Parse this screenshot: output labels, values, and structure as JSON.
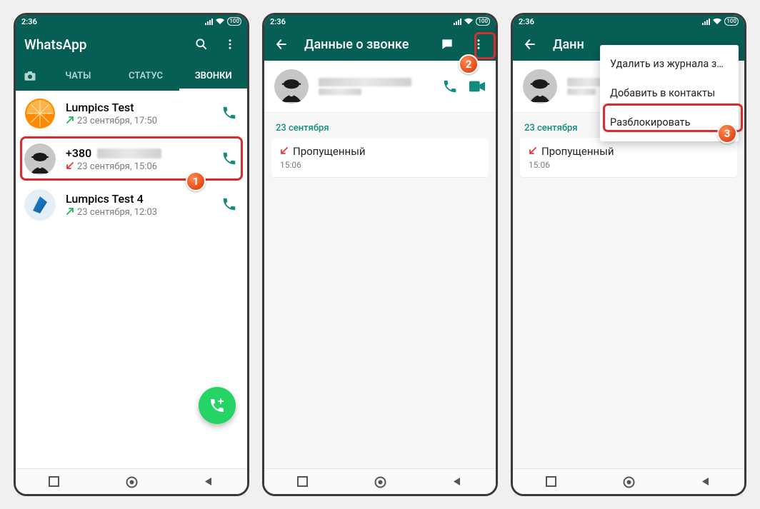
{
  "status": {
    "time": "2:36",
    "battery": "100"
  },
  "screen1": {
    "header_title": "WhatsApp",
    "tabs": {
      "chats": "ЧАТЫ",
      "status": "СТАТУС",
      "calls": "ЗВОНКИ"
    },
    "calls": [
      {
        "name": "Lumpics Test",
        "subtitle": "23 сентября, 17:50",
        "dir": "out"
      },
      {
        "name": "+380",
        "subtitle": "23 сентября, 15:06",
        "dir": "miss"
      },
      {
        "name": "Lumpics Test 4",
        "subtitle": "23 сентября, 12:03",
        "dir": "out"
      }
    ],
    "step_label": "1"
  },
  "screen2": {
    "header_title": "Данные о звонке",
    "date_label": "23 сентября",
    "missed_label": "Пропущенный",
    "missed_time": "15:06",
    "step_label": "2"
  },
  "screen3": {
    "header_title_partial": "Данн",
    "menu": {
      "delete": "Удалить из журнала звонков",
      "add": "Добавить в контакты",
      "unblock": "Разблокировать"
    },
    "date_label": "23 сентября",
    "missed_label": "Пропущенный",
    "missed_time": "15:06",
    "step_label": "3"
  }
}
